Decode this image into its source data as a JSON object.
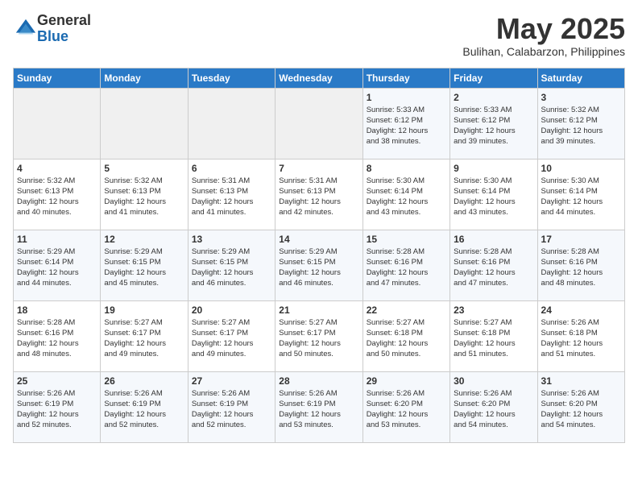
{
  "logo": {
    "general": "General",
    "blue": "Blue"
  },
  "title": "May 2025",
  "subtitle": "Bulihan, Calabarzon, Philippines",
  "days": [
    "Sunday",
    "Monday",
    "Tuesday",
    "Wednesday",
    "Thursday",
    "Friday",
    "Saturday"
  ],
  "weeks": [
    [
      {
        "day": "",
        "info": ""
      },
      {
        "day": "",
        "info": ""
      },
      {
        "day": "",
        "info": ""
      },
      {
        "day": "",
        "info": ""
      },
      {
        "day": "1",
        "info": "Sunrise: 5:33 AM\nSunset: 6:12 PM\nDaylight: 12 hours\nand 38 minutes."
      },
      {
        "day": "2",
        "info": "Sunrise: 5:33 AM\nSunset: 6:12 PM\nDaylight: 12 hours\nand 39 minutes."
      },
      {
        "day": "3",
        "info": "Sunrise: 5:32 AM\nSunset: 6:12 PM\nDaylight: 12 hours\nand 39 minutes."
      }
    ],
    [
      {
        "day": "4",
        "info": "Sunrise: 5:32 AM\nSunset: 6:13 PM\nDaylight: 12 hours\nand 40 minutes."
      },
      {
        "day": "5",
        "info": "Sunrise: 5:32 AM\nSunset: 6:13 PM\nDaylight: 12 hours\nand 41 minutes."
      },
      {
        "day": "6",
        "info": "Sunrise: 5:31 AM\nSunset: 6:13 PM\nDaylight: 12 hours\nand 41 minutes."
      },
      {
        "day": "7",
        "info": "Sunrise: 5:31 AM\nSunset: 6:13 PM\nDaylight: 12 hours\nand 42 minutes."
      },
      {
        "day": "8",
        "info": "Sunrise: 5:30 AM\nSunset: 6:14 PM\nDaylight: 12 hours\nand 43 minutes."
      },
      {
        "day": "9",
        "info": "Sunrise: 5:30 AM\nSunset: 6:14 PM\nDaylight: 12 hours\nand 43 minutes."
      },
      {
        "day": "10",
        "info": "Sunrise: 5:30 AM\nSunset: 6:14 PM\nDaylight: 12 hours\nand 44 minutes."
      }
    ],
    [
      {
        "day": "11",
        "info": "Sunrise: 5:29 AM\nSunset: 6:14 PM\nDaylight: 12 hours\nand 44 minutes."
      },
      {
        "day": "12",
        "info": "Sunrise: 5:29 AM\nSunset: 6:15 PM\nDaylight: 12 hours\nand 45 minutes."
      },
      {
        "day": "13",
        "info": "Sunrise: 5:29 AM\nSunset: 6:15 PM\nDaylight: 12 hours\nand 46 minutes."
      },
      {
        "day": "14",
        "info": "Sunrise: 5:29 AM\nSunset: 6:15 PM\nDaylight: 12 hours\nand 46 minutes."
      },
      {
        "day": "15",
        "info": "Sunrise: 5:28 AM\nSunset: 6:16 PM\nDaylight: 12 hours\nand 47 minutes."
      },
      {
        "day": "16",
        "info": "Sunrise: 5:28 AM\nSunset: 6:16 PM\nDaylight: 12 hours\nand 47 minutes."
      },
      {
        "day": "17",
        "info": "Sunrise: 5:28 AM\nSunset: 6:16 PM\nDaylight: 12 hours\nand 48 minutes."
      }
    ],
    [
      {
        "day": "18",
        "info": "Sunrise: 5:28 AM\nSunset: 6:16 PM\nDaylight: 12 hours\nand 48 minutes."
      },
      {
        "day": "19",
        "info": "Sunrise: 5:27 AM\nSunset: 6:17 PM\nDaylight: 12 hours\nand 49 minutes."
      },
      {
        "day": "20",
        "info": "Sunrise: 5:27 AM\nSunset: 6:17 PM\nDaylight: 12 hours\nand 49 minutes."
      },
      {
        "day": "21",
        "info": "Sunrise: 5:27 AM\nSunset: 6:17 PM\nDaylight: 12 hours\nand 50 minutes."
      },
      {
        "day": "22",
        "info": "Sunrise: 5:27 AM\nSunset: 6:18 PM\nDaylight: 12 hours\nand 50 minutes."
      },
      {
        "day": "23",
        "info": "Sunrise: 5:27 AM\nSunset: 6:18 PM\nDaylight: 12 hours\nand 51 minutes."
      },
      {
        "day": "24",
        "info": "Sunrise: 5:26 AM\nSunset: 6:18 PM\nDaylight: 12 hours\nand 51 minutes."
      }
    ],
    [
      {
        "day": "25",
        "info": "Sunrise: 5:26 AM\nSunset: 6:19 PM\nDaylight: 12 hours\nand 52 minutes."
      },
      {
        "day": "26",
        "info": "Sunrise: 5:26 AM\nSunset: 6:19 PM\nDaylight: 12 hours\nand 52 minutes."
      },
      {
        "day": "27",
        "info": "Sunrise: 5:26 AM\nSunset: 6:19 PM\nDaylight: 12 hours\nand 52 minutes."
      },
      {
        "day": "28",
        "info": "Sunrise: 5:26 AM\nSunset: 6:19 PM\nDaylight: 12 hours\nand 53 minutes."
      },
      {
        "day": "29",
        "info": "Sunrise: 5:26 AM\nSunset: 6:20 PM\nDaylight: 12 hours\nand 53 minutes."
      },
      {
        "day": "30",
        "info": "Sunrise: 5:26 AM\nSunset: 6:20 PM\nDaylight: 12 hours\nand 54 minutes."
      },
      {
        "day": "31",
        "info": "Sunrise: 5:26 AM\nSunset: 6:20 PM\nDaylight: 12 hours\nand 54 minutes."
      }
    ]
  ]
}
